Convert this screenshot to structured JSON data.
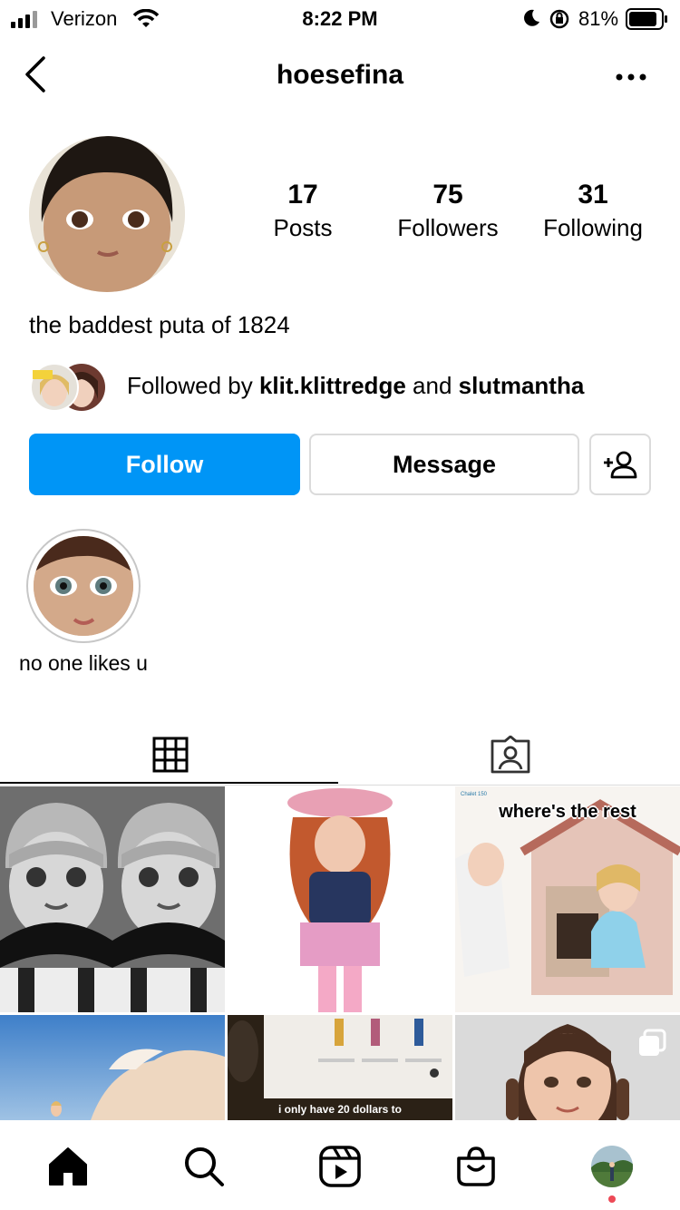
{
  "status_bar": {
    "carrier": "Verizon",
    "time": "8:22 PM",
    "battery": "81%"
  },
  "header": {
    "username": "hoesefina"
  },
  "stats": [
    {
      "count": "17",
      "label": "Posts"
    },
    {
      "count": "75",
      "label": "Followers"
    },
    {
      "count": "31",
      "label": "Following"
    }
  ],
  "bio": "the baddest puta of 1824",
  "followed_by": {
    "prefix": "Followed by ",
    "user1": "klit.klittredge",
    "joiner": " and ",
    "user2": "slutmantha"
  },
  "buttons": {
    "follow": "Follow",
    "message": "Message"
  },
  "highlights": [
    {
      "label": "no one likes u"
    }
  ],
  "tabs": [
    {
      "icon": "grid-icon",
      "active": true
    },
    {
      "icon": "tagged-icon",
      "active": false
    }
  ],
  "posts": [
    {
      "caption": ""
    },
    {
      "caption": ""
    },
    {
      "caption": "where's the rest",
      "small_text": "Chalet 150"
    },
    {
      "caption": ""
    },
    {
      "caption": "i only have 20 dollars to"
    },
    {
      "caption": ""
    }
  ],
  "bottom_nav": [
    "home-icon",
    "search-icon",
    "reels-icon",
    "shop-icon",
    "profile-avatar"
  ],
  "colors": {
    "accent": "#0095f6",
    "border": "#dbdbdb",
    "notification": "#ed4956"
  }
}
